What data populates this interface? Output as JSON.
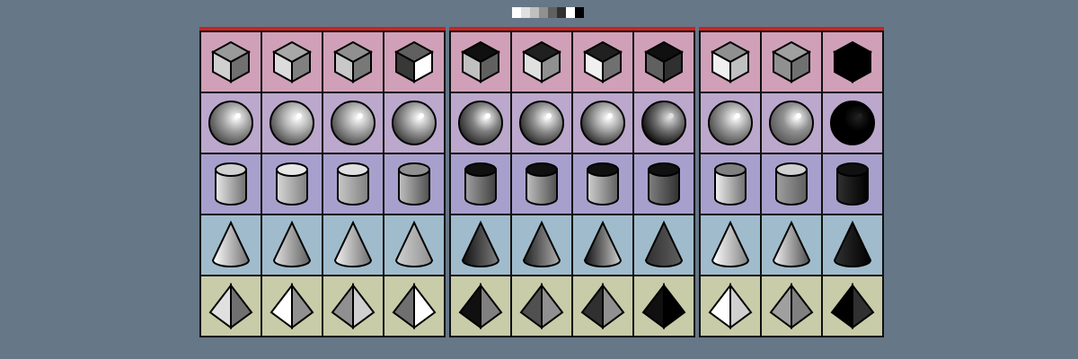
{
  "palette": {
    "swatches": [
      "#ffffff",
      "#e0e0e0",
      "#c0c0c0",
      "#909090",
      "#606060",
      "#303030",
      "#ffffff",
      "#000000"
    ]
  },
  "row_colors": [
    "#d0a0b8",
    "#bca8cc",
    "#a8a0cc",
    "#a0bccc",
    "#c8cca8"
  ],
  "shapes_by_row": [
    "cube",
    "sphere",
    "cylinder",
    "cone",
    "pyramid"
  ],
  "panels": [
    {
      "name": "light",
      "columns": 4,
      "rows": [
        [
          {
            "a": "#9a9a9a",
            "b": "#d0d0d0",
            "c": "#707070"
          },
          {
            "a": "#a8a8a8",
            "b": "#dcdcdc",
            "c": "#808080"
          },
          {
            "a": "#909090",
            "b": "#c8c8c8",
            "c": "#787878"
          },
          {
            "a": "#606060",
            "b": "#383838",
            "c": "#ffffff"
          }
        ],
        [
          {
            "base": "#a0a0a0",
            "hi": "#ffffff",
            "dark": "#404040"
          },
          {
            "base": "#b0b0b0",
            "hi": "#ffffff",
            "dark": "#404040"
          },
          {
            "base": "#a8a8a8",
            "hi": "#ffffff",
            "dark": "#404040"
          },
          {
            "base": "#a0a0a0",
            "hi": "#ffffff",
            "dark": "#303030"
          }
        ],
        [
          {
            "top": "#d0d0d0",
            "l": "#e8e8e8",
            "r": "#707070"
          },
          {
            "top": "#e8e8e8",
            "l": "#d8d8d8",
            "r": "#808080"
          },
          {
            "top": "#e0e0e0",
            "l": "#c8c8c8",
            "r": "#808080"
          },
          {
            "top": "#909090",
            "l": "#c0c0c0",
            "r": "#505050"
          }
        ],
        [
          {
            "l": "#ffffff",
            "r": "#707070"
          },
          {
            "l": "#e0e0e0",
            "r": "#606060"
          },
          {
            "l": "#f0f0f0",
            "r": "#707070"
          },
          {
            "l": "#d0d0d0",
            "r": "#909090"
          }
        ],
        [
          {
            "l": "#e0e0e0",
            "r": "#707070"
          },
          {
            "l": "#ffffff",
            "r": "#909090"
          },
          {
            "l": "#909090",
            "r": "#d0d0d0"
          },
          {
            "l": "#707070",
            "r": "#ffffff"
          }
        ]
      ]
    },
    {
      "name": "dark",
      "columns": 4,
      "rows": [
        [
          {
            "a": "#101010",
            "b": "#c0c0c0",
            "c": "#606060"
          },
          {
            "a": "#202020",
            "b": "#e0e0e0",
            "c": "#909090"
          },
          {
            "a": "#202020",
            "b": "#f0f0f0",
            "c": "#707070"
          },
          {
            "a": "#101010",
            "b": "#606060",
            "c": "#303030"
          }
        ],
        [
          {
            "base": "#808080",
            "hi": "#ffffff",
            "dark": "#202020"
          },
          {
            "base": "#909090",
            "hi": "#ffffff",
            "dark": "#202020"
          },
          {
            "base": "#a0a0a0",
            "hi": "#ffffff",
            "dark": "#202020"
          },
          {
            "base": "#707070",
            "hi": "#e0e0e0",
            "dark": "#000000"
          }
        ],
        [
          {
            "top": "#101010",
            "l": "#a0a0a0",
            "r": "#404040"
          },
          {
            "top": "#101010",
            "l": "#c0c0c0",
            "r": "#505050"
          },
          {
            "top": "#101010",
            "l": "#d0d0d0",
            "r": "#606060"
          },
          {
            "top": "#101010",
            "l": "#808080",
            "r": "#303030"
          }
        ],
        [
          {
            "l": "#101010",
            "r": "#808080"
          },
          {
            "l": "#202020",
            "r": "#b0b0b0"
          },
          {
            "l": "#101010",
            "r": "#d0d0d0"
          },
          {
            "l": "#303030",
            "r": "#606060"
          }
        ],
        [
          {
            "l": "#101010",
            "r": "#808080"
          },
          {
            "l": "#505050",
            "r": "#909090"
          },
          {
            "l": "#303030",
            "r": "#909090"
          },
          {
            "l": "#101010",
            "r": "#000000"
          }
        ]
      ]
    },
    {
      "name": "mixed",
      "columns": 3,
      "rows": [
        [
          {
            "a": "#909090",
            "b": "#f0f0f0",
            "c": "#c0c0c0"
          },
          {
            "a": "#a0a0a0",
            "b": "#909090",
            "c": "#707070"
          },
          {
            "a": "#000000",
            "b": "#000000",
            "c": "#000000"
          }
        ],
        [
          {
            "base": "#a0a0a0",
            "hi": "#ffffff",
            "dark": "#404040"
          },
          {
            "base": "#909090",
            "hi": "#ffffff",
            "dark": "#505050"
          },
          {
            "base": "#000000",
            "hi": "#202020",
            "dark": "#000000"
          }
        ],
        [
          {
            "top": "#808080",
            "l": "#f0f0f0",
            "r": "#707070"
          },
          {
            "top": "#d0d0d0",
            "l": "#a0a0a0",
            "r": "#606060"
          },
          {
            "top": "#101010",
            "l": "#303030",
            "r": "#000000"
          }
        ],
        [
          {
            "l": "#ffffff",
            "r": "#808080"
          },
          {
            "l": "#f0f0f0",
            "r": "#505050"
          },
          {
            "l": "#303030",
            "r": "#000000"
          }
        ],
        [
          {
            "l": "#ffffff",
            "r": "#d0d0d0"
          },
          {
            "l": "#a0a0a0",
            "r": "#808080"
          },
          {
            "l": "#000000",
            "r": "#303030"
          }
        ]
      ]
    }
  ]
}
